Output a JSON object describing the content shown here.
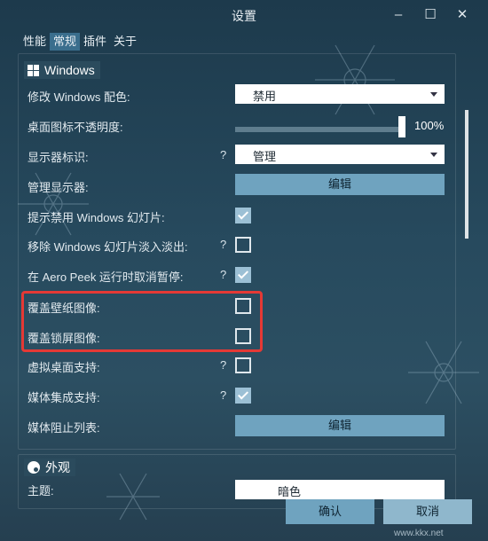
{
  "window": {
    "title": "设置",
    "minimize_icon": "minimize-icon",
    "maximize_icon": "maximize-icon",
    "close_icon": "close-icon"
  },
  "tabs": [
    {
      "label": "性能",
      "active": false
    },
    {
      "label": "常规",
      "active": true
    },
    {
      "label": "插件",
      "active": false
    },
    {
      "label": "关于",
      "active": false
    }
  ],
  "windows_section": {
    "title": "Windows",
    "icon": "windows-logo-icon",
    "rows": {
      "color": {
        "label": "修改 Windows 配色:",
        "value": "禁用"
      },
      "opacity": {
        "label": "桌面图标不透明度:",
        "value": "100%",
        "level": 1.0
      },
      "monitor_id": {
        "label": "显示器标识:",
        "help": "?",
        "value": "管理"
      },
      "manage_monitors": {
        "label": "管理显示器:",
        "button": "编辑"
      },
      "slideshow_disabled": {
        "label": "提示禁用 Windows 幻灯片:",
        "checked": true
      },
      "slideshow_fade": {
        "label": "移除 Windows 幻灯片淡入淡出:",
        "help": "?",
        "checked": false
      },
      "aero_peek": {
        "label": "在 Aero Peek 运行时取消暂停:",
        "help": "?",
        "checked": true
      },
      "override_wallpaper": {
        "label": "覆盖壁纸图像:",
        "checked": false
      },
      "override_lockscreen": {
        "label": "覆盖锁屏图像:",
        "checked": false
      },
      "virtual_desktop": {
        "label": "虚拟桌面支持:",
        "help": "?",
        "checked": false
      },
      "media_integration": {
        "label": "媒体集成支持:",
        "help": "?",
        "checked": true
      },
      "media_blocklist": {
        "label": "媒体阻止列表:",
        "button": "编辑"
      }
    }
  },
  "appearance_section": {
    "title": "外观",
    "icon": "palette-icon",
    "theme_label": "主题:",
    "theme_value": "暗色"
  },
  "footer": {
    "ok": "确认",
    "cancel": "取消"
  },
  "watermark": "www.kkx.net",
  "colors": {
    "accent": "#6fa3bf",
    "highlight": "#e53935"
  }
}
